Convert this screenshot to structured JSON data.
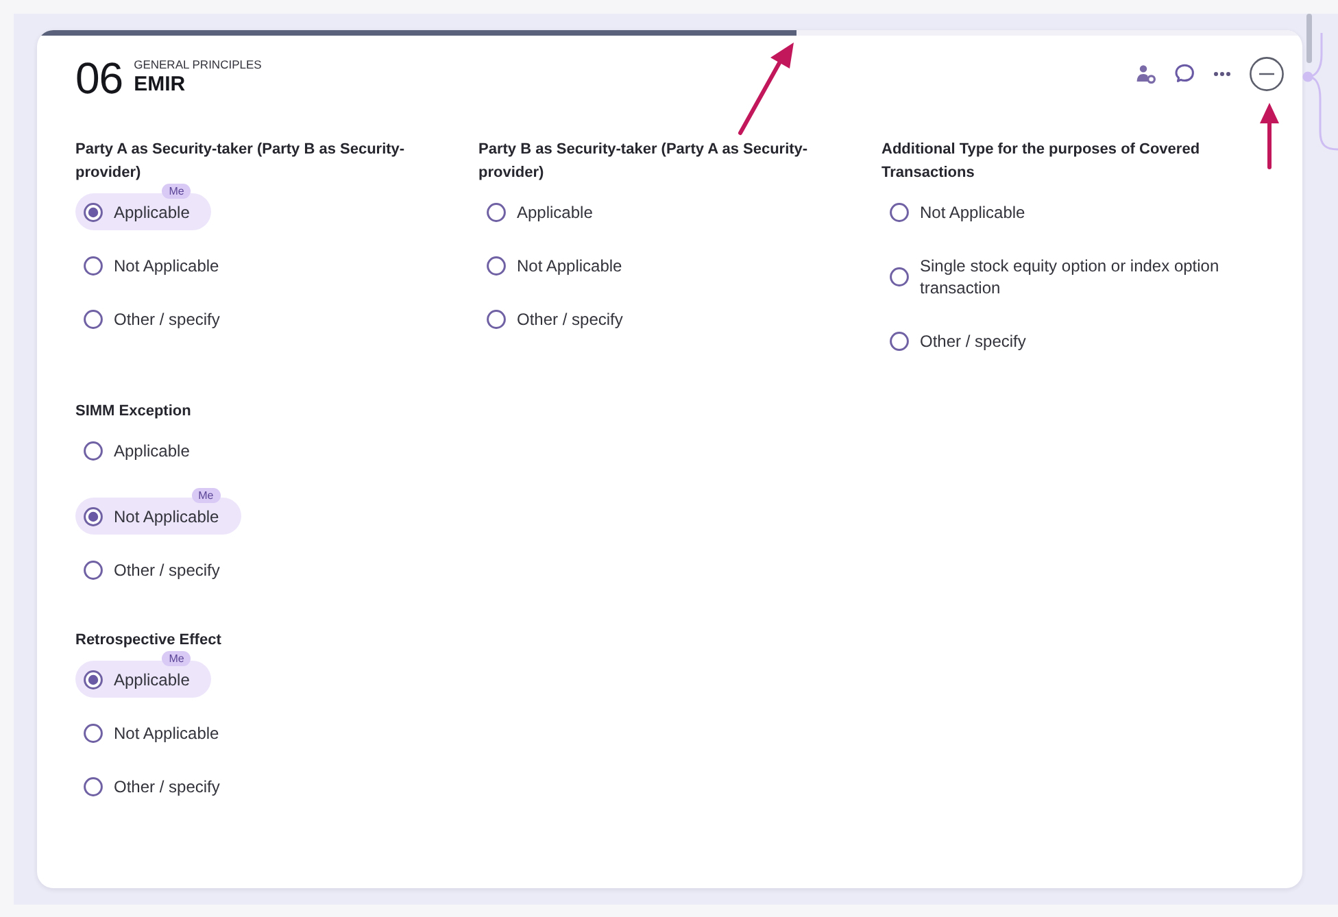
{
  "header": {
    "number": "06",
    "category": "GENERAL PRINCIPLES",
    "title": "EMIR"
  },
  "progress": {
    "level": 0.6
  },
  "rows": [
    {
      "questions": [
        {
          "label": "Party A as Security-taker (Party B as Security-provider)",
          "options": [
            {
              "label": "Applicable",
              "selected": true,
              "badge": "Me"
            },
            {
              "label": "Not Applicable",
              "selected": false
            },
            {
              "label": "Other / specify",
              "selected": false
            }
          ]
        },
        {
          "label": "Party B as Security-taker (Party A as Security-provider)",
          "options": [
            {
              "label": "Applicable",
              "selected": false
            },
            {
              "label": "Not Applicable",
              "selected": false
            },
            {
              "label": "Other / specify",
              "selected": false
            }
          ]
        },
        {
          "label": "Additional Type for the purposes of Covered Transactions",
          "options": [
            {
              "label": "Not Applicable",
              "selected": false
            },
            {
              "label": "Single stock equity option or index option transaction",
              "selected": false
            },
            {
              "label": "Other / specify",
              "selected": false
            }
          ]
        }
      ]
    },
    {
      "questions": [
        {
          "label": "SIMM Exception",
          "options": [
            {
              "label": "Applicable",
              "selected": false
            },
            {
              "label": "Not Applicable",
              "selected": true,
              "badge": "Me"
            },
            {
              "label": "Other / specify",
              "selected": false
            }
          ]
        }
      ]
    },
    {
      "questions": [
        {
          "label": "Retrospective Effect",
          "options": [
            {
              "label": "Applicable",
              "selected": true,
              "badge": "Me"
            },
            {
              "label": "Not Applicable",
              "selected": false
            },
            {
              "label": "Other / specify",
              "selected": false
            }
          ]
        }
      ]
    }
  ]
}
